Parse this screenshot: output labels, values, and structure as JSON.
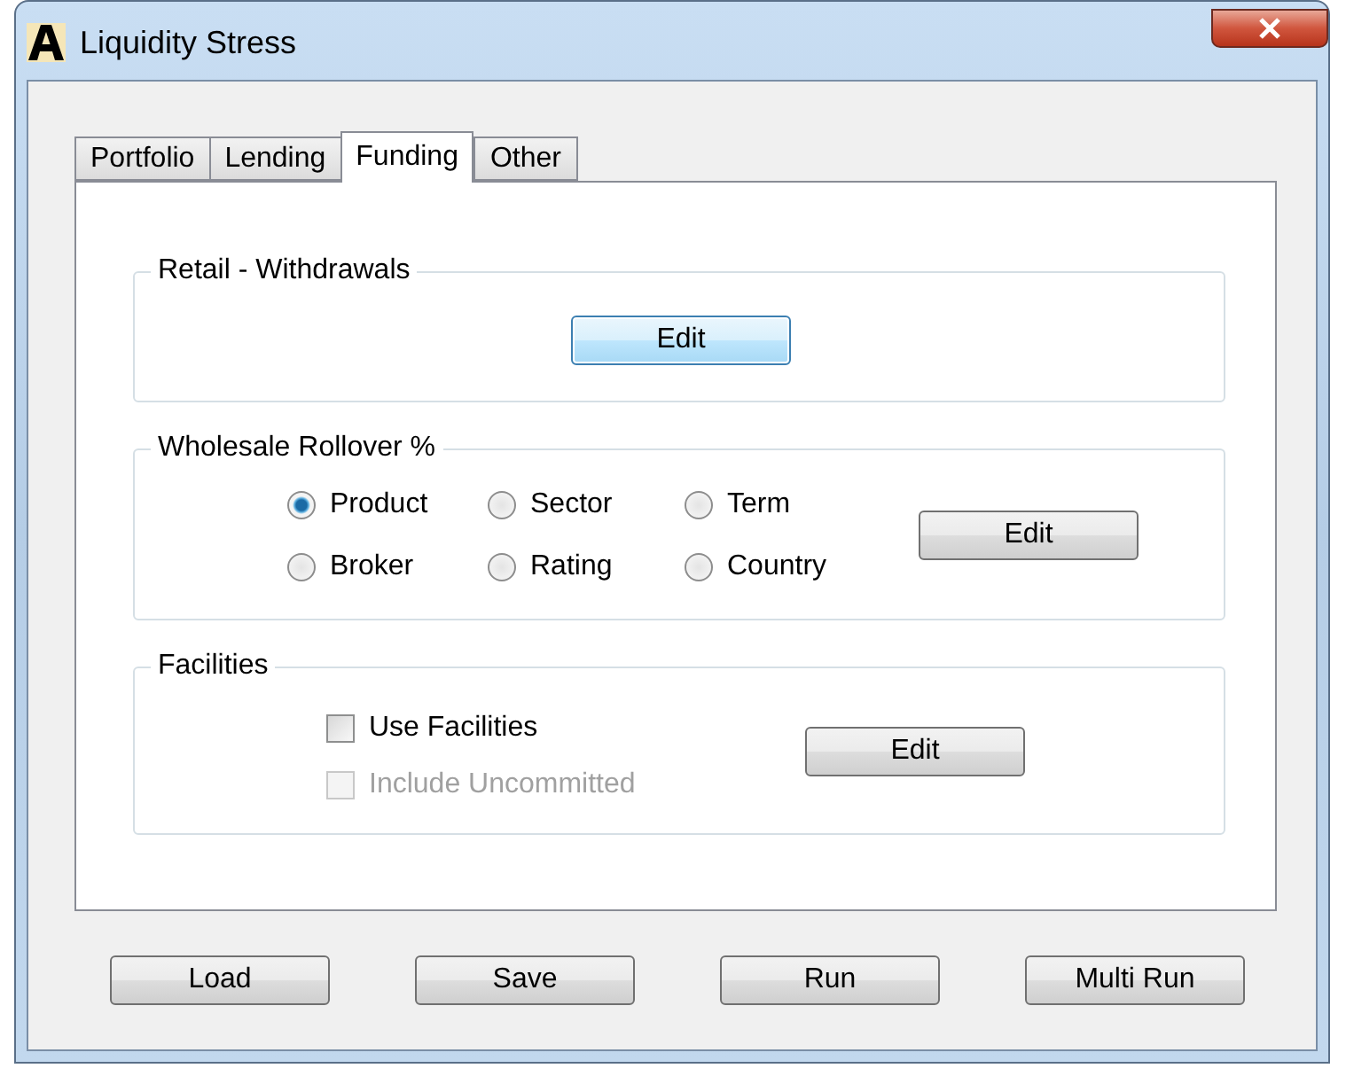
{
  "window": {
    "title": "Liquidity Stress"
  },
  "tabs": [
    {
      "label": "Portfolio",
      "selected": false
    },
    {
      "label": "Lending",
      "selected": false
    },
    {
      "label": "Funding",
      "selected": true
    },
    {
      "label": "Other",
      "selected": false
    }
  ],
  "retail": {
    "title": "Retail - Withdrawals",
    "button": "Edit"
  },
  "wholesale": {
    "title": "Wholesale Rollover %",
    "options": [
      {
        "label": "Product",
        "selected": true
      },
      {
        "label": "Sector",
        "selected": false
      },
      {
        "label": "Term",
        "selected": false
      },
      {
        "label": "Broker",
        "selected": false
      },
      {
        "label": "Rating",
        "selected": false
      },
      {
        "label": "Country",
        "selected": false
      }
    ],
    "button": "Edit"
  },
  "facilities": {
    "title": "Facilities",
    "checks": [
      {
        "label": "Use Facilities",
        "checked": false,
        "disabled": false
      },
      {
        "label": "Include Uncommitted",
        "checked": false,
        "disabled": true
      }
    ],
    "button": "Edit"
  },
  "buttons": [
    "Load",
    "Save",
    "Run",
    "Multi Run"
  ]
}
